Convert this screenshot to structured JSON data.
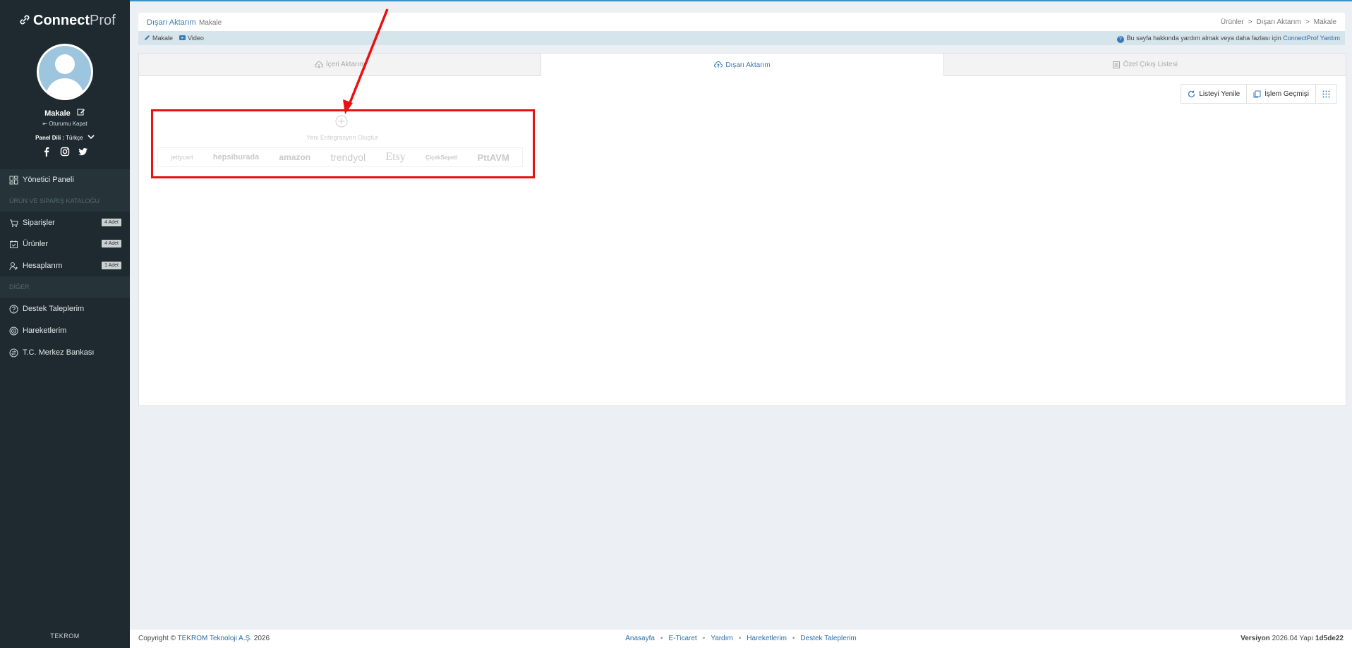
{
  "sidebar": {
    "brand_bold": "Connect",
    "brand_light": "Prof",
    "user_name": "Makale",
    "logout": "Oturumu Kapat",
    "lang_label": "Panel Dili :",
    "lang_value": "Türkçe",
    "items": [
      {
        "label": "Yönetici Paneli",
        "icon": "dashboard-icon"
      },
      {
        "label": "Siparişler",
        "badge": "4 Adet",
        "icon": "cart-icon"
      },
      {
        "label": "Ürünler",
        "badge": "4 Adet",
        "icon": "box-icon"
      },
      {
        "label": "Hesaplarım",
        "badge": "1 Adet",
        "icon": "users-icon"
      },
      {
        "label": "Destek Taleplerim",
        "icon": "help-icon"
      },
      {
        "label": "Hareketlerim",
        "icon": "activity-icon"
      },
      {
        "label": "T.C. Merkez Bankası",
        "icon": "exchange-icon"
      }
    ],
    "sections": [
      "ÜRÜN VE SİPARİŞ KATALOĞU",
      "DİĞER"
    ],
    "footer": "TEKROM"
  },
  "header": {
    "title": "Dışarı Aktarım",
    "subtitle": "Makale",
    "breadcrumb": [
      "Ürünler",
      "Dışarı Aktarım",
      "Makale"
    ],
    "sep": ">",
    "sublinks": [
      "Makale",
      "Video"
    ],
    "help_text": "Bu sayfa hakkında yardım almak veya daha fazlası için",
    "help_link": "ConnectProf Yardım"
  },
  "tabs": [
    {
      "label": "İçeri Aktarım"
    },
    {
      "label": "Dışarı Aktarım"
    },
    {
      "label": "Özel Çıkış Listesi"
    }
  ],
  "actions": {
    "refresh": "Listeyi Yenile",
    "history": "İşlem Geçmişi"
  },
  "integration": {
    "new_label": "Yeni Entegrasyon Oluştur",
    "logos": [
      "jettycart",
      "hepsiburada",
      "amazon",
      "trendyol",
      "Etsy",
      "ÇiçekSepeti",
      "PttAVM"
    ]
  },
  "footer": {
    "copy_prefix": "Copyright ©",
    "company": "TEKROM Teknoloji A.Ş.",
    "year": "2026",
    "links": [
      "Anasayfa",
      "E-Ticaret",
      "Yardım",
      "Hareketlerim",
      "Destek Taleplerim"
    ],
    "dot": "•",
    "version_label": "Versiyon",
    "version": "2026.04",
    "build_label": "Yapı",
    "build": "1d5de22"
  },
  "colors": {
    "accent": "#3a7ab5",
    "sidebar": "#1e2a30",
    "highlight": "#e81010"
  }
}
